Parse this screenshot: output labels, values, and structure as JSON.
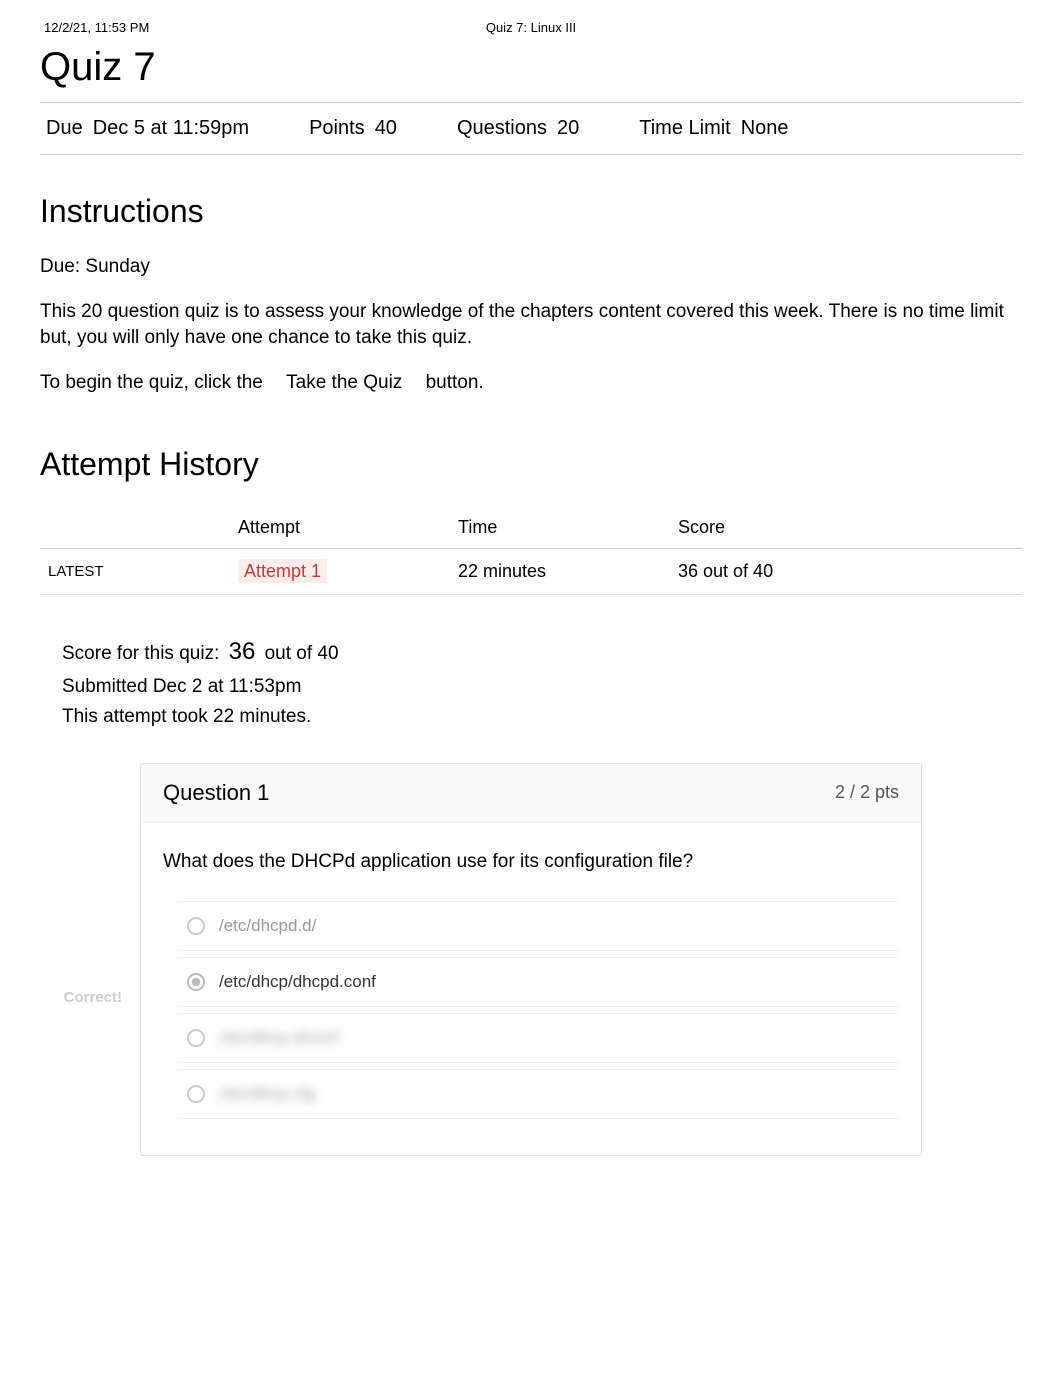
{
  "print_header": {
    "timestamp": "12/2/21, 11:53 PM",
    "doc_title": "Quiz 7: Linux III"
  },
  "title": "Quiz 7",
  "meta": {
    "due_label": "Due",
    "due_value": "Dec 5 at 11:59pm",
    "points_label": "Points",
    "points_value": "40",
    "questions_label": "Questions",
    "questions_value": "20",
    "timelimit_label": "Time Limit",
    "timelimit_value": "None"
  },
  "instructions": {
    "heading": "Instructions",
    "line1": "Due: Sunday",
    "line2": "This 20 question quiz is to assess your knowledge of the chapters content covered this week. There is no time limit but, you will only have one chance to take this quiz.",
    "line3_before": "To begin the quiz, click the ",
    "line3_button": "Take the Quiz",
    "line3_after": " button."
  },
  "attempt_history": {
    "heading": "Attempt History",
    "columns": {
      "blank": "",
      "attempt": "Attempt",
      "time": "Time",
      "score": "Score"
    },
    "rows": [
      {
        "tag": "LATEST",
        "attempt_label": "Attempt 1",
        "time": "22 minutes",
        "score": "36 out of 40"
      }
    ]
  },
  "score_block": {
    "score_label": "Score for this quiz: ",
    "score_value": "36",
    "score_suffix": " out of 40",
    "submitted": "Submitted Dec 2 at 11:53pm",
    "took": "This attempt took 22 minutes."
  },
  "question1": {
    "gutter_label": "Correct!",
    "header_label": "Question 1",
    "points": "2 / 2 pts",
    "text": "What does the DHCPd application use for its configuration file?",
    "answers": [
      {
        "text": "/etc/dhcpd.d/",
        "faded": true,
        "selected": false,
        "hidden": false
      },
      {
        "text": "/etc/dhcp/dhcpd.conf",
        "faded": false,
        "selected": true,
        "hidden": false
      },
      {
        "text": "/etc/dhcp.d/conf",
        "faded": false,
        "selected": false,
        "hidden": true
      },
      {
        "text": "/etc/dhcp.cfg",
        "faded": false,
        "selected": false,
        "hidden": true
      }
    ]
  }
}
